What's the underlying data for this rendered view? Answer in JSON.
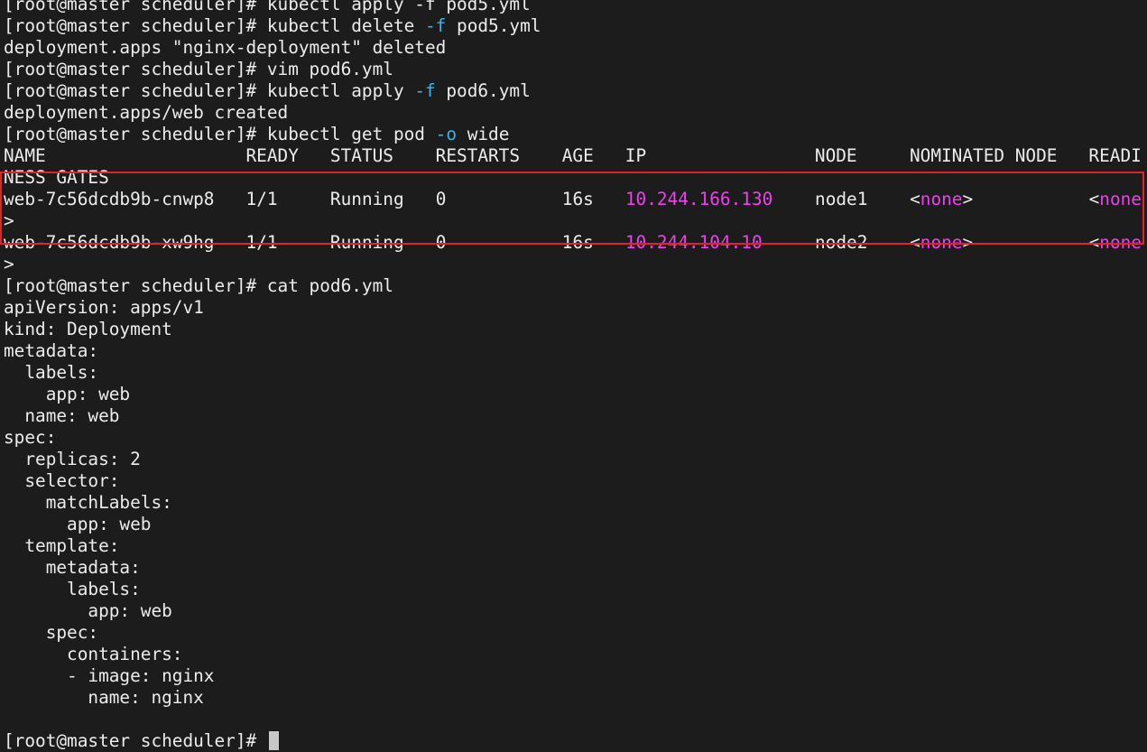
{
  "prompt": "[root@master scheduler]# ",
  "top_partial_line": "[root@master scheduler]# kubectl apply -f pod5.yml",
  "commands": {
    "delete": {
      "verb": "kubectl delete ",
      "flag": "-f",
      "rest": " pod5.yml"
    },
    "delete_output": "deployment.apps \"nginx-deployment\" deleted",
    "vim": "vim pod6.yml",
    "apply": {
      "verb": "kubectl apply ",
      "flag": "-f",
      "rest": " pod6.yml"
    },
    "apply_output": "deployment.apps/web created",
    "get": {
      "verb": "kubectl get pod ",
      "flag": "-o",
      "rest": " wide"
    },
    "cat": "cat pod6.yml"
  },
  "table": {
    "header_line": "NAME                   READY   STATUS    RESTARTS    AGE   IP                NODE     NOMINATED NODE   READI",
    "header_wrap": "NESS GATES",
    "rows": [
      {
        "name": "web-7c56dcdb9b-cnwp8",
        "ready": "1/1",
        "status": "Running",
        "restarts": "0",
        "age": "16s",
        "ip": "10.244.166.130",
        "node": "node1",
        "nominated_node_open": "<",
        "nominated_node_value": "none",
        "nominated_node_close": ">",
        "readiness_open": "<",
        "readiness_value": "none",
        "readiness_wrap": ">"
      },
      {
        "name": "web-7c56dcdb9b-xw9hg",
        "ready": "1/1",
        "status": "Running",
        "restarts": "0",
        "age": "16s",
        "ip": "10.244.104.10",
        "node": "node2",
        "nominated_node_open": "<",
        "nominated_node_value": "none",
        "nominated_node_close": ">",
        "readiness_open": "<",
        "readiness_value": "none",
        "readiness_wrap": ">"
      }
    ]
  },
  "yaml_lines": [
    "apiVersion: apps/v1",
    "kind: Deployment",
    "metadata:",
    "  labels:",
    "    app: web",
    "  name: web",
    "spec:",
    "  replicas: 2",
    "  selector:",
    "    matchLabels:",
    "      app: web",
    "  template:",
    "    metadata:",
    "      labels:",
    "        app: web",
    "    spec:",
    "      containers:",
    "      - image: nginx",
    "        name: nginx",
    ""
  ],
  "colors": {
    "background": "#1c1c1c",
    "text": "#ececec",
    "flag": "#38b6e6",
    "magenta": "#ee40ee",
    "highlight_border": "#e3232b"
  }
}
